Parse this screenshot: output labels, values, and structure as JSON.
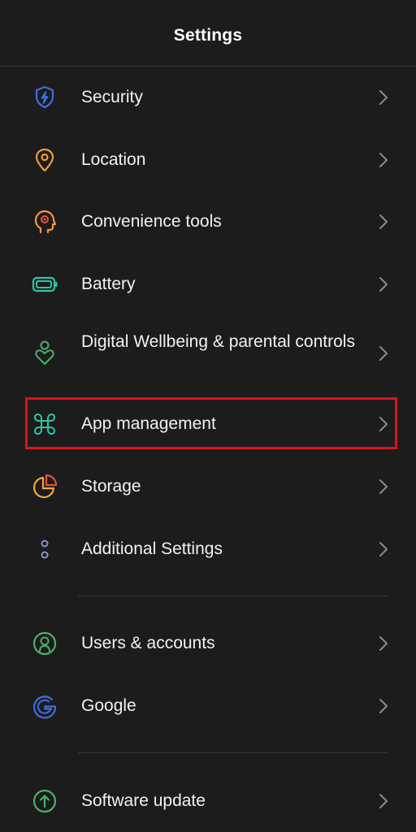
{
  "header": {
    "title": "Settings"
  },
  "items": [
    {
      "label": "Security",
      "icon": "security-shield-icon",
      "color": "#3d6fe0"
    },
    {
      "label": "Location",
      "icon": "location-pin-icon",
      "color": "#f09a3e"
    },
    {
      "label": "Convenience tools",
      "icon": "convenience-tools-head-icon",
      "color": "#f09a3e"
    },
    {
      "label": "Battery",
      "icon": "battery-icon",
      "color": "#2fc4a8"
    },
    {
      "label": "Digital Wellbeing & parental controls",
      "icon": "wellbeing-heart-person-icon",
      "color": "#4caf6a"
    },
    {
      "label": "App management",
      "icon": "app-management-grid-icon",
      "color": "#2fc4a8"
    },
    {
      "label": "Storage",
      "icon": "storage-pie-icon",
      "color": "#f0a83e"
    },
    {
      "label": "Additional Settings",
      "icon": "additional-settings-dots-icon",
      "color": "#8a94c8"
    },
    {
      "label": "Users & accounts",
      "icon": "user-account-icon",
      "color": "#4caf6a"
    },
    {
      "label": "Google",
      "icon": "google-g-icon",
      "color": "#3d6fe0"
    },
    {
      "label": "Software update",
      "icon": "software-update-arrow-icon",
      "color": "#4caf6a"
    }
  ],
  "highlighted_item": "App management",
  "colors": {
    "background": "#1c1c1c",
    "highlight_border": "#d9141c",
    "chevron": "#8a8a8a"
  }
}
